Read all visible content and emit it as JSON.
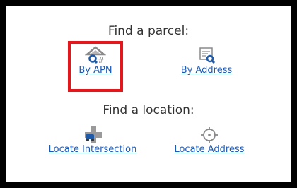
{
  "parcel_section": {
    "heading": "Find a parcel:",
    "by_apn_label": "By APN",
    "by_address_label": "By Address"
  },
  "location_section": {
    "heading": "Find a location:",
    "locate_intersection_label": "Locate Intersection",
    "locate_address_label": "Locate Address"
  },
  "icons": {
    "by_apn": "house-hash-search-icon",
    "by_address": "document-search-icon",
    "locate_intersection": "intersection-car-icon",
    "locate_address": "crosshair-target-icon"
  },
  "colors": {
    "link": "#1a5bb8",
    "icon_blue": "#1e5aa8",
    "icon_gray": "#8a8a8a",
    "highlight": "#e8151b"
  }
}
